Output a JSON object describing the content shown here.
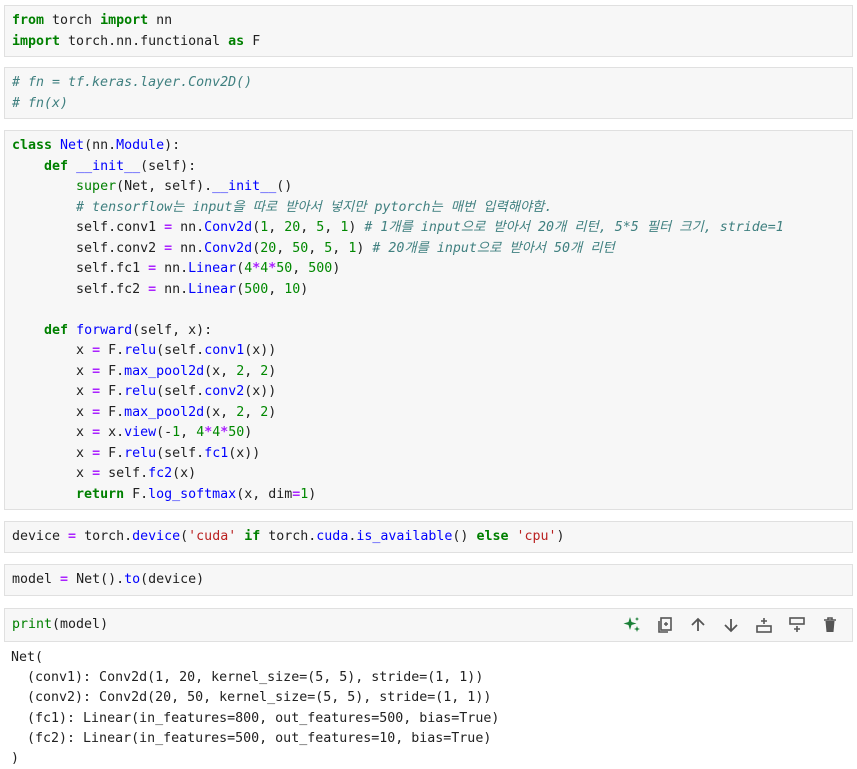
{
  "cells": [
    {
      "id": "import",
      "lines": [
        "from torch import nn",
        "import torch.nn.functional as F"
      ]
    },
    {
      "id": "comment",
      "lines": [
        "# fn = tf.keras.layer.Conv2D()",
        "# fn(x)"
      ]
    },
    {
      "id": "net-class",
      "lines": [
        "class Net(nn.Module):",
        "    def __init__(self):",
        "        super(Net, self).__init__()",
        "        # tensorflow는 input을 따로 받아서 넣지만 pytorch는 매번 입력해야함.",
        "        self.conv1 = nn.Conv2d(1, 20, 5, 1) # 1개를 input으로 받아서 20개 리턴, 5*5 필터 크기, stride=1",
        "        self.conv2 = nn.Conv2d(20, 50, 5, 1) # 20개를 input으로 받아서 50개 리턴",
        "        self.fc1 = nn.Linear(4*4*50, 500)",
        "        self.fc2 = nn.Linear(500, 10)",
        "",
        "    def forward(self, x):",
        "        x = F.relu(self.conv1(x))",
        "        x = F.max_pool2d(x, 2, 2)",
        "        x = F.relu(self.conv2(x))",
        "        x = F.max_pool2d(x, 2, 2)",
        "        x = x.view(-1, 4*4*50)",
        "        x = F.relu(self.fc1(x))",
        "        x = self.fc2(x)",
        "        return F.log_softmax(x, dim=1)"
      ]
    },
    {
      "id": "device",
      "lines": [
        "device = torch.device('cuda' if torch.cuda.is_available() else 'cpu')"
      ]
    },
    {
      "id": "model",
      "lines": [
        "model = Net().to(device)"
      ]
    },
    {
      "id": "print",
      "lines": [
        "print(model)"
      ]
    }
  ],
  "output": {
    "lines": [
      "Net(",
      "  (conv1): Conv2d(1, 20, kernel_size=(5, 5), stride=(1, 1))",
      "  (conv2): Conv2d(20, 50, kernel_size=(5, 5), stride=(1, 1))",
      "  (fc1): Linear(in_features=800, out_features=500, bias=True)",
      "  (fc2): Linear(in_features=500, out_features=10, bias=True)",
      ")"
    ]
  },
  "toolbar": {
    "icons": [
      "sparkle-icon",
      "copy-icon",
      "arrow-up-icon",
      "arrow-down-icon",
      "insert-below-icon",
      "insert-above-icon",
      "delete-icon"
    ],
    "accent_color": "#1a7f37"
  }
}
